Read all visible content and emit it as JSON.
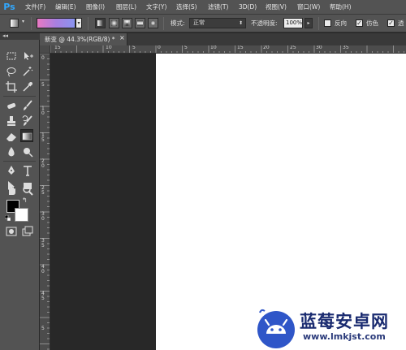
{
  "app": {
    "logo_text": "Ps"
  },
  "menu": [
    "文件(F)",
    "编辑(E)",
    "图像(I)",
    "图层(L)",
    "文字(Y)",
    "选择(S)",
    "滤镜(T)",
    "3D(D)",
    "视图(V)",
    "窗口(W)",
    "帮助(H)"
  ],
  "options": {
    "mode_label": "模式:",
    "mode_value": "正常",
    "opacity_label": "不透明度:",
    "opacity_value": "100%",
    "reverse_label": "反向",
    "dither_label": "仿色",
    "transparency_label": "透",
    "reverse_checked": false,
    "dither_checked": true,
    "transparency_checked": true,
    "gradient_colors": [
      "#e879c2",
      "#a87fe0",
      "#8a94f0"
    ]
  },
  "document": {
    "tab_title": "新变 @ 44.3%(RGB/8) *",
    "tab_close": "×"
  },
  "rulers": {
    "h_labels": [
      "15",
      "10",
      "5",
      "0",
      "5",
      "10",
      "15",
      "20",
      "25",
      "30",
      "35"
    ],
    "v_labels": [
      "0",
      "5",
      "1 0",
      "1 5",
      "2 0",
      "2 5",
      "3 0",
      "3 5",
      "4 0",
      "4 5",
      "5"
    ]
  },
  "colors": {
    "foreground": "#000000",
    "background": "#ffffff"
  },
  "watermark": {
    "title": "蓝莓安卓网",
    "url": "www.lmkjst.com"
  }
}
